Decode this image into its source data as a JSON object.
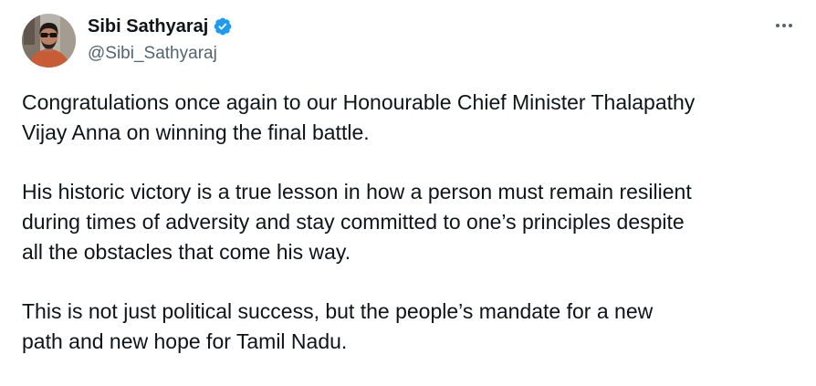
{
  "tweet": {
    "author": {
      "display_name": "Sibi Sathyaraj",
      "handle": "@Sibi_Sathyaraj",
      "verified": true,
      "verified_color": "#1d9bf0"
    },
    "more_icon": "more-horizontal-icon",
    "paragraphs": [
      {
        "lines": [
          "Congratulations once again to our Honourable Chief Minister Thalapathy",
          "Vijay Anna on winning the final battle."
        ]
      },
      {
        "lines": [
          "His historic victory is a true lesson in how a person must remain resilient",
          "during times of adversity and stay committed to one’s principles despite",
          "all the obstacles that come his way."
        ]
      },
      {
        "lines": [
          "This is not just political success, but the people’s mandate for a new",
          "path and new hope for Tamil Nadu."
        ]
      }
    ]
  },
  "colors": {
    "text_primary": "#0f1419",
    "text_secondary": "#536471",
    "background": "#ffffff"
  }
}
